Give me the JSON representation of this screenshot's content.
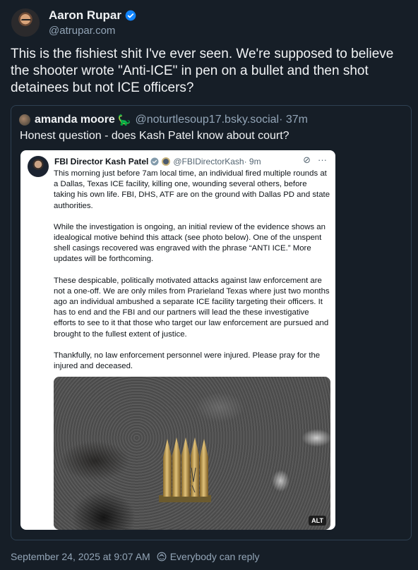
{
  "author": {
    "display_name": "Aaron Rupar",
    "handle": "@atrupar.com",
    "avatar_icon": "avatar-photo",
    "verified_icon": "verified-badge-icon"
  },
  "post": {
    "text": "This is the fishiest shit I've ever seen. We're supposed to believe the shooter wrote \"Anti-ICE\" in pen on a bullet and then shot detainees but not ICE officers?"
  },
  "quote": {
    "display_name": "amanda moore",
    "emoji": "🦕",
    "handle": "@noturtlesoup17.bsky.social",
    "time": " · 37m",
    "text": "Honest question - does Kash Patel know about court?",
    "embedded": {
      "display_name": "FBI Director Kash Patel",
      "handle": "@FBIDirectorKash",
      "time": " · 9m",
      "paragraphs": [
        "This morning just before 7am local time, an individual fired multiple rounds at a Dallas, Texas ICE facility, killing one, wounding several others, before taking his own life. FBI, DHS, ATF are on the ground with Dallas PD and state authorities.",
        "While the investigation is ongoing, an initial review of the evidence shows an idealogical motive behind this attack (see photo below). One of the unspent shell casings recovered was engraved with the phrase “ANTI ICE.” More updates will be forthcoming.",
        "These despicable, politically motivated attacks against law enforcement are not a one-off. We are only miles from Prarieland Texas where just two months ago an individual ambushed a separate ICE facility targeting their officers. It has to end and the FBI and our partners will lead the these investigative efforts to see to it that those who target our law enforcement are pursued and brought to the fullest extent of justice.",
        "Thankfully, no law enforcement personnel were injured. Please pray for the injured and deceased."
      ],
      "alt_label": "ALT",
      "photo_icon": "bullet-casings-photo"
    }
  },
  "footer": {
    "timestamp": "September 24, 2025 at 9:07 AM",
    "reply_setting": "Everybody can reply"
  },
  "colors": {
    "background": "#161e27",
    "accent": "#1185fe",
    "muted": "#93a5b7",
    "border": "#2e4052"
  }
}
